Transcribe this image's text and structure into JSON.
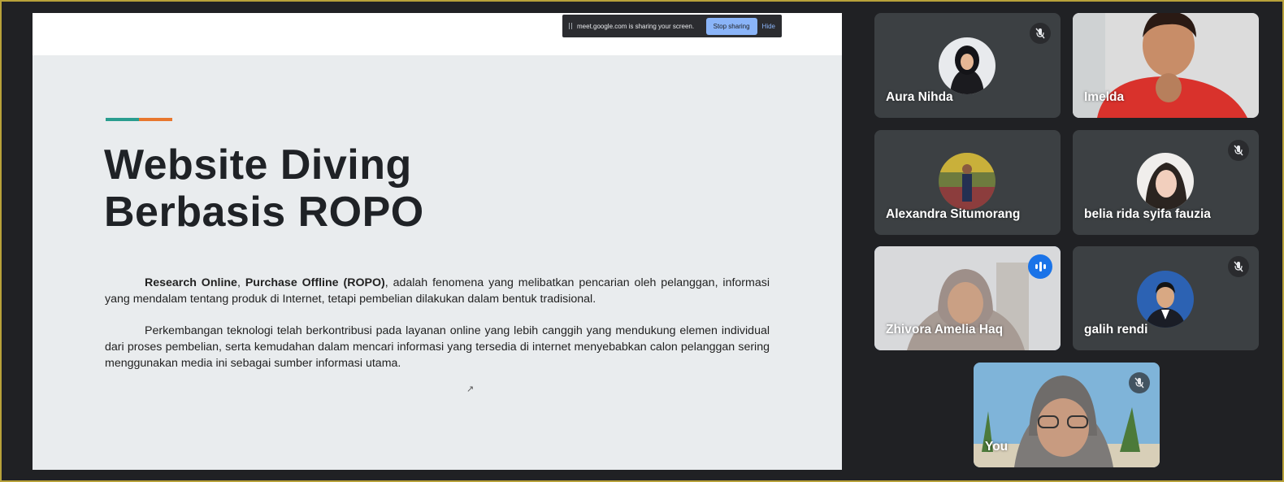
{
  "share_bar": {
    "message": "meet.google.com is sharing your screen.",
    "stop_label": "Stop sharing",
    "hide_label": "Hide"
  },
  "slide": {
    "title_line1": "Website Diving",
    "title_line2": "Berbasis ROPO",
    "accent_colors": [
      "#2a9d8f",
      "#e8772e"
    ],
    "paragraphs": [
      {
        "bold1": "Research Online",
        "sep": ", ",
        "bold2": "Purchase Offline (ROPO)",
        "rest": ", adalah fenomena yang melibatkan pencarian oleh pelanggan, informasi yang mendalam tentang produk di Internet, tetapi pembelian dilakukan dalam bentuk tradisional."
      },
      {
        "text": "Perkembangan teknologi telah berkontribusi pada layanan online yang lebih canggih yang mendukung elemen individual dari proses pembelian, serta kemudahan dalam mencari informasi yang tersedia di internet menyebabkan calon pelanggan sering menggunakan media ini sebagai sumber informasi utama."
      }
    ]
  },
  "participants": [
    {
      "name": "Aura Nihda",
      "muted": true
    },
    {
      "name": "Imelda",
      "muted": false
    },
    {
      "name": "Alexandra Situmorang",
      "muted": false
    },
    {
      "name": "belia rida syifa fauzia",
      "muted": true
    },
    {
      "name": "Zhivora Amelia Haq",
      "muted": false,
      "speaking": true
    },
    {
      "name": "galih rendi",
      "muted": true
    },
    {
      "name": "You",
      "muted": true
    }
  ],
  "colors": {
    "background": "#202124",
    "tile": "#3c4043",
    "accent_blue": "#8ab4f8",
    "speaking_blue": "#1a73e8"
  },
  "icons": {
    "muted": "mic-off-icon",
    "speaking": "audio-level-icon",
    "share_grip": "grip-icon",
    "cursor": "mouse-cursor-icon"
  }
}
